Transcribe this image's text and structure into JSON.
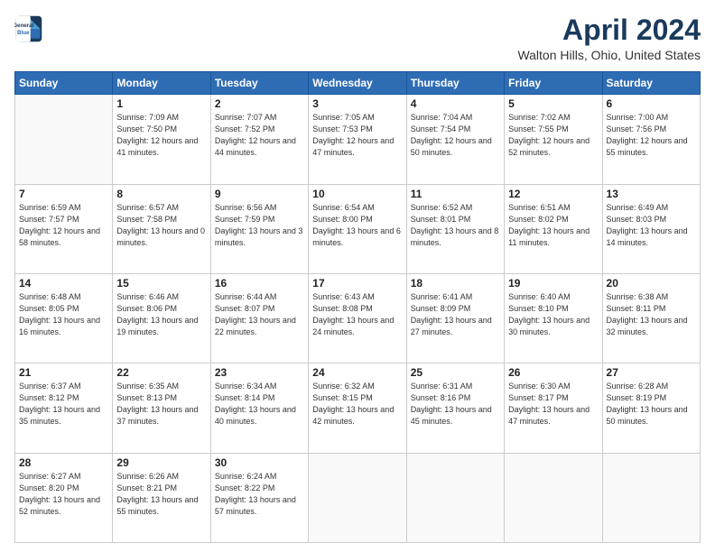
{
  "logo": {
    "line1": "General",
    "line2": "Blue"
  },
  "title": "April 2024",
  "subtitle": "Walton Hills, Ohio, United States",
  "days_of_week": [
    "Sunday",
    "Monday",
    "Tuesday",
    "Wednesday",
    "Thursday",
    "Friday",
    "Saturday"
  ],
  "weeks": [
    [
      {
        "day": "",
        "sunrise": "",
        "sunset": "",
        "daylight": ""
      },
      {
        "day": "1",
        "sunrise": "Sunrise: 7:09 AM",
        "sunset": "Sunset: 7:50 PM",
        "daylight": "Daylight: 12 hours and 41 minutes."
      },
      {
        "day": "2",
        "sunrise": "Sunrise: 7:07 AM",
        "sunset": "Sunset: 7:52 PM",
        "daylight": "Daylight: 12 hours and 44 minutes."
      },
      {
        "day": "3",
        "sunrise": "Sunrise: 7:05 AM",
        "sunset": "Sunset: 7:53 PM",
        "daylight": "Daylight: 12 hours and 47 minutes."
      },
      {
        "day": "4",
        "sunrise": "Sunrise: 7:04 AM",
        "sunset": "Sunset: 7:54 PM",
        "daylight": "Daylight: 12 hours and 50 minutes."
      },
      {
        "day": "5",
        "sunrise": "Sunrise: 7:02 AM",
        "sunset": "Sunset: 7:55 PM",
        "daylight": "Daylight: 12 hours and 52 minutes."
      },
      {
        "day": "6",
        "sunrise": "Sunrise: 7:00 AM",
        "sunset": "Sunset: 7:56 PM",
        "daylight": "Daylight: 12 hours and 55 minutes."
      }
    ],
    [
      {
        "day": "7",
        "sunrise": "Sunrise: 6:59 AM",
        "sunset": "Sunset: 7:57 PM",
        "daylight": "Daylight: 12 hours and 58 minutes."
      },
      {
        "day": "8",
        "sunrise": "Sunrise: 6:57 AM",
        "sunset": "Sunset: 7:58 PM",
        "daylight": "Daylight: 13 hours and 0 minutes."
      },
      {
        "day": "9",
        "sunrise": "Sunrise: 6:56 AM",
        "sunset": "Sunset: 7:59 PM",
        "daylight": "Daylight: 13 hours and 3 minutes."
      },
      {
        "day": "10",
        "sunrise": "Sunrise: 6:54 AM",
        "sunset": "Sunset: 8:00 PM",
        "daylight": "Daylight: 13 hours and 6 minutes."
      },
      {
        "day": "11",
        "sunrise": "Sunrise: 6:52 AM",
        "sunset": "Sunset: 8:01 PM",
        "daylight": "Daylight: 13 hours and 8 minutes."
      },
      {
        "day": "12",
        "sunrise": "Sunrise: 6:51 AM",
        "sunset": "Sunset: 8:02 PM",
        "daylight": "Daylight: 13 hours and 11 minutes."
      },
      {
        "day": "13",
        "sunrise": "Sunrise: 6:49 AM",
        "sunset": "Sunset: 8:03 PM",
        "daylight": "Daylight: 13 hours and 14 minutes."
      }
    ],
    [
      {
        "day": "14",
        "sunrise": "Sunrise: 6:48 AM",
        "sunset": "Sunset: 8:05 PM",
        "daylight": "Daylight: 13 hours and 16 minutes."
      },
      {
        "day": "15",
        "sunrise": "Sunrise: 6:46 AM",
        "sunset": "Sunset: 8:06 PM",
        "daylight": "Daylight: 13 hours and 19 minutes."
      },
      {
        "day": "16",
        "sunrise": "Sunrise: 6:44 AM",
        "sunset": "Sunset: 8:07 PM",
        "daylight": "Daylight: 13 hours and 22 minutes."
      },
      {
        "day": "17",
        "sunrise": "Sunrise: 6:43 AM",
        "sunset": "Sunset: 8:08 PM",
        "daylight": "Daylight: 13 hours and 24 minutes."
      },
      {
        "day": "18",
        "sunrise": "Sunrise: 6:41 AM",
        "sunset": "Sunset: 8:09 PM",
        "daylight": "Daylight: 13 hours and 27 minutes."
      },
      {
        "day": "19",
        "sunrise": "Sunrise: 6:40 AM",
        "sunset": "Sunset: 8:10 PM",
        "daylight": "Daylight: 13 hours and 30 minutes."
      },
      {
        "day": "20",
        "sunrise": "Sunrise: 6:38 AM",
        "sunset": "Sunset: 8:11 PM",
        "daylight": "Daylight: 13 hours and 32 minutes."
      }
    ],
    [
      {
        "day": "21",
        "sunrise": "Sunrise: 6:37 AM",
        "sunset": "Sunset: 8:12 PM",
        "daylight": "Daylight: 13 hours and 35 minutes."
      },
      {
        "day": "22",
        "sunrise": "Sunrise: 6:35 AM",
        "sunset": "Sunset: 8:13 PM",
        "daylight": "Daylight: 13 hours and 37 minutes."
      },
      {
        "day": "23",
        "sunrise": "Sunrise: 6:34 AM",
        "sunset": "Sunset: 8:14 PM",
        "daylight": "Daylight: 13 hours and 40 minutes."
      },
      {
        "day": "24",
        "sunrise": "Sunrise: 6:32 AM",
        "sunset": "Sunset: 8:15 PM",
        "daylight": "Daylight: 13 hours and 42 minutes."
      },
      {
        "day": "25",
        "sunrise": "Sunrise: 6:31 AM",
        "sunset": "Sunset: 8:16 PM",
        "daylight": "Daylight: 13 hours and 45 minutes."
      },
      {
        "day": "26",
        "sunrise": "Sunrise: 6:30 AM",
        "sunset": "Sunset: 8:17 PM",
        "daylight": "Daylight: 13 hours and 47 minutes."
      },
      {
        "day": "27",
        "sunrise": "Sunrise: 6:28 AM",
        "sunset": "Sunset: 8:19 PM",
        "daylight": "Daylight: 13 hours and 50 minutes."
      }
    ],
    [
      {
        "day": "28",
        "sunrise": "Sunrise: 6:27 AM",
        "sunset": "Sunset: 8:20 PM",
        "daylight": "Daylight: 13 hours and 52 minutes."
      },
      {
        "day": "29",
        "sunrise": "Sunrise: 6:26 AM",
        "sunset": "Sunset: 8:21 PM",
        "daylight": "Daylight: 13 hours and 55 minutes."
      },
      {
        "day": "30",
        "sunrise": "Sunrise: 6:24 AM",
        "sunset": "Sunset: 8:22 PM",
        "daylight": "Daylight: 13 hours and 57 minutes."
      },
      {
        "day": "",
        "sunrise": "",
        "sunset": "",
        "daylight": ""
      },
      {
        "day": "",
        "sunrise": "",
        "sunset": "",
        "daylight": ""
      },
      {
        "day": "",
        "sunrise": "",
        "sunset": "",
        "daylight": ""
      },
      {
        "day": "",
        "sunrise": "",
        "sunset": "",
        "daylight": ""
      }
    ]
  ]
}
